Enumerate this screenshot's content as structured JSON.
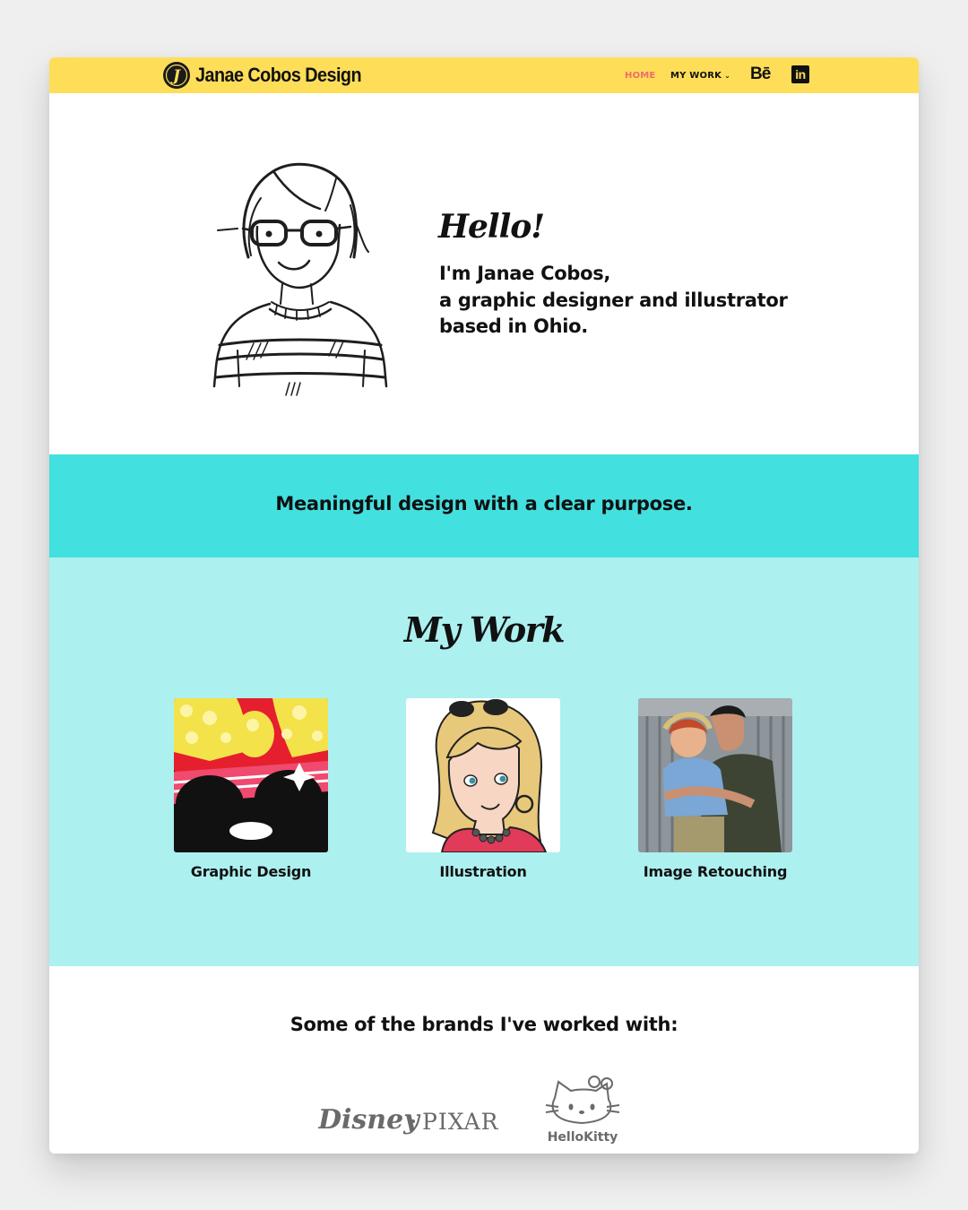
{
  "header": {
    "logo_text": "Janae Cobos Design",
    "logo_initial": "J",
    "nav": {
      "home": "HOME",
      "my_work": "MY WORK"
    },
    "behance_label": "Bē",
    "linkedin_label": "in"
  },
  "hero": {
    "greeting": "Hello!",
    "intro_line1": "I'm Janae Cobos,",
    "intro_line2": "a graphic designer and illustrator",
    "intro_line3": "based in Ohio."
  },
  "tagline": "Meaningful design with a clear purpose.",
  "work": {
    "title": "My Work",
    "items": [
      {
        "label": "Graphic Design"
      },
      {
        "label": "Illustration"
      },
      {
        "label": "Image Retouching"
      }
    ]
  },
  "brands": {
    "title": "Some of the brands I've worked with:",
    "disney": "Disney",
    "pixar": "PIXAR",
    "hellokitty": "HelloKitty"
  },
  "colors": {
    "header_bg": "#fede58",
    "nav_active": "#f06a6a",
    "tagline_bg": "#43e0e0",
    "work_bg": "#adf0f0",
    "page_bg": "#efeff0"
  }
}
